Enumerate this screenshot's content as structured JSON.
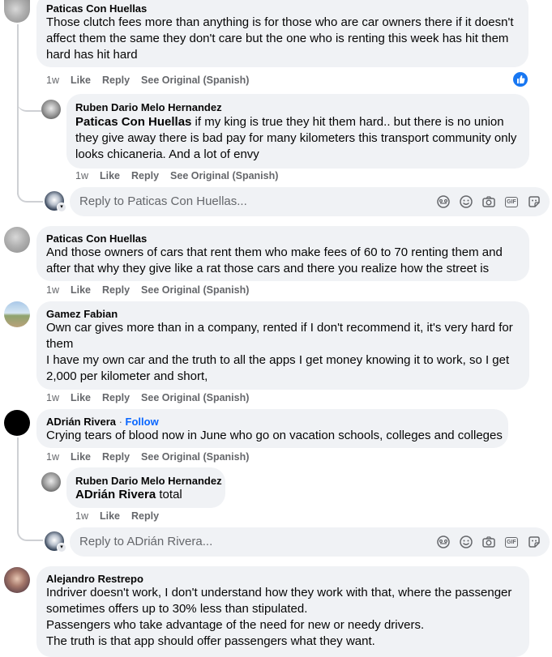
{
  "icons": {
    "like": "like-icon",
    "sticker": "sticker-icon",
    "emoji": "emoji-icon",
    "camera": "camera-icon",
    "gif": "gif-icon",
    "avatar_sticker": "avatar-sticker-icon"
  },
  "colors": {
    "accent": "#0866ff",
    "bubble": "#f0f2f5",
    "secondary_text": "#65676b"
  },
  "actions": {
    "like": "Like",
    "reply": "Reply",
    "see_original": "See Original (Spanish)",
    "follow": "Follow",
    "gif": "GIF"
  },
  "comments": [
    {
      "author": "Paticas Con Huellas",
      "lines": [
        "Those clutch fees more than anything is for those who are car owners there if it doesn't",
        "affect them the same they don't care but the one who is renting this week has hit them",
        "hard has hit hard"
      ],
      "time": "1w",
      "replies": [
        {
          "author": "Ruben Dario Melo Hernandez",
          "mention": "Paticas Con Huellas",
          "lines": [
            " if my king is true they hit them hard.. but there is no union",
            "they give away there is bad pay for many kilometers this transport community only",
            "looks chicaneria. And a lot of envy"
          ],
          "time": "1w"
        }
      ],
      "reply_placeholder": "Reply to Paticas Con Huellas..."
    },
    {
      "author": "Paticas Con Huellas",
      "lines": [
        "And those owners of cars that rent them who make fees of 60 to 70 renting them and",
        "after that why they give like a rat those cars and there you realize how the street is"
      ],
      "time": "1w"
    },
    {
      "author": "Gamez Fabian",
      "lines": [
        "Own car gives more than in a company, rented if I don't recommend it, it's very hard for",
        "them",
        "I have my own car and the truth to all the apps I get money knowing it to work, so I get",
        "2,000 per kilometer and short,"
      ],
      "time": "1w"
    },
    {
      "author": "ADrián Rivera",
      "separator": " · ",
      "lines": [
        "Crying tears of blood now in June who go on vacation schools, colleges and colleges"
      ],
      "time": "1w",
      "replies": [
        {
          "author": "Ruben Dario Melo Hernandez",
          "mention": "ADrián Rivera",
          "text": " total",
          "time": "1w"
        }
      ],
      "reply_placeholder": "Reply to ADrián Rivera..."
    },
    {
      "author": "Alejandro Restrepo",
      "lines": [
        "Indriver doesn't work, I don't understand how they work with that, where the passenger",
        "sometimes offers up to 30% less than stipulated.",
        "Passengers who take advantage of the need for new or needy drivers.",
        "The truth is that app should offer passengers what they want."
      ]
    }
  ]
}
